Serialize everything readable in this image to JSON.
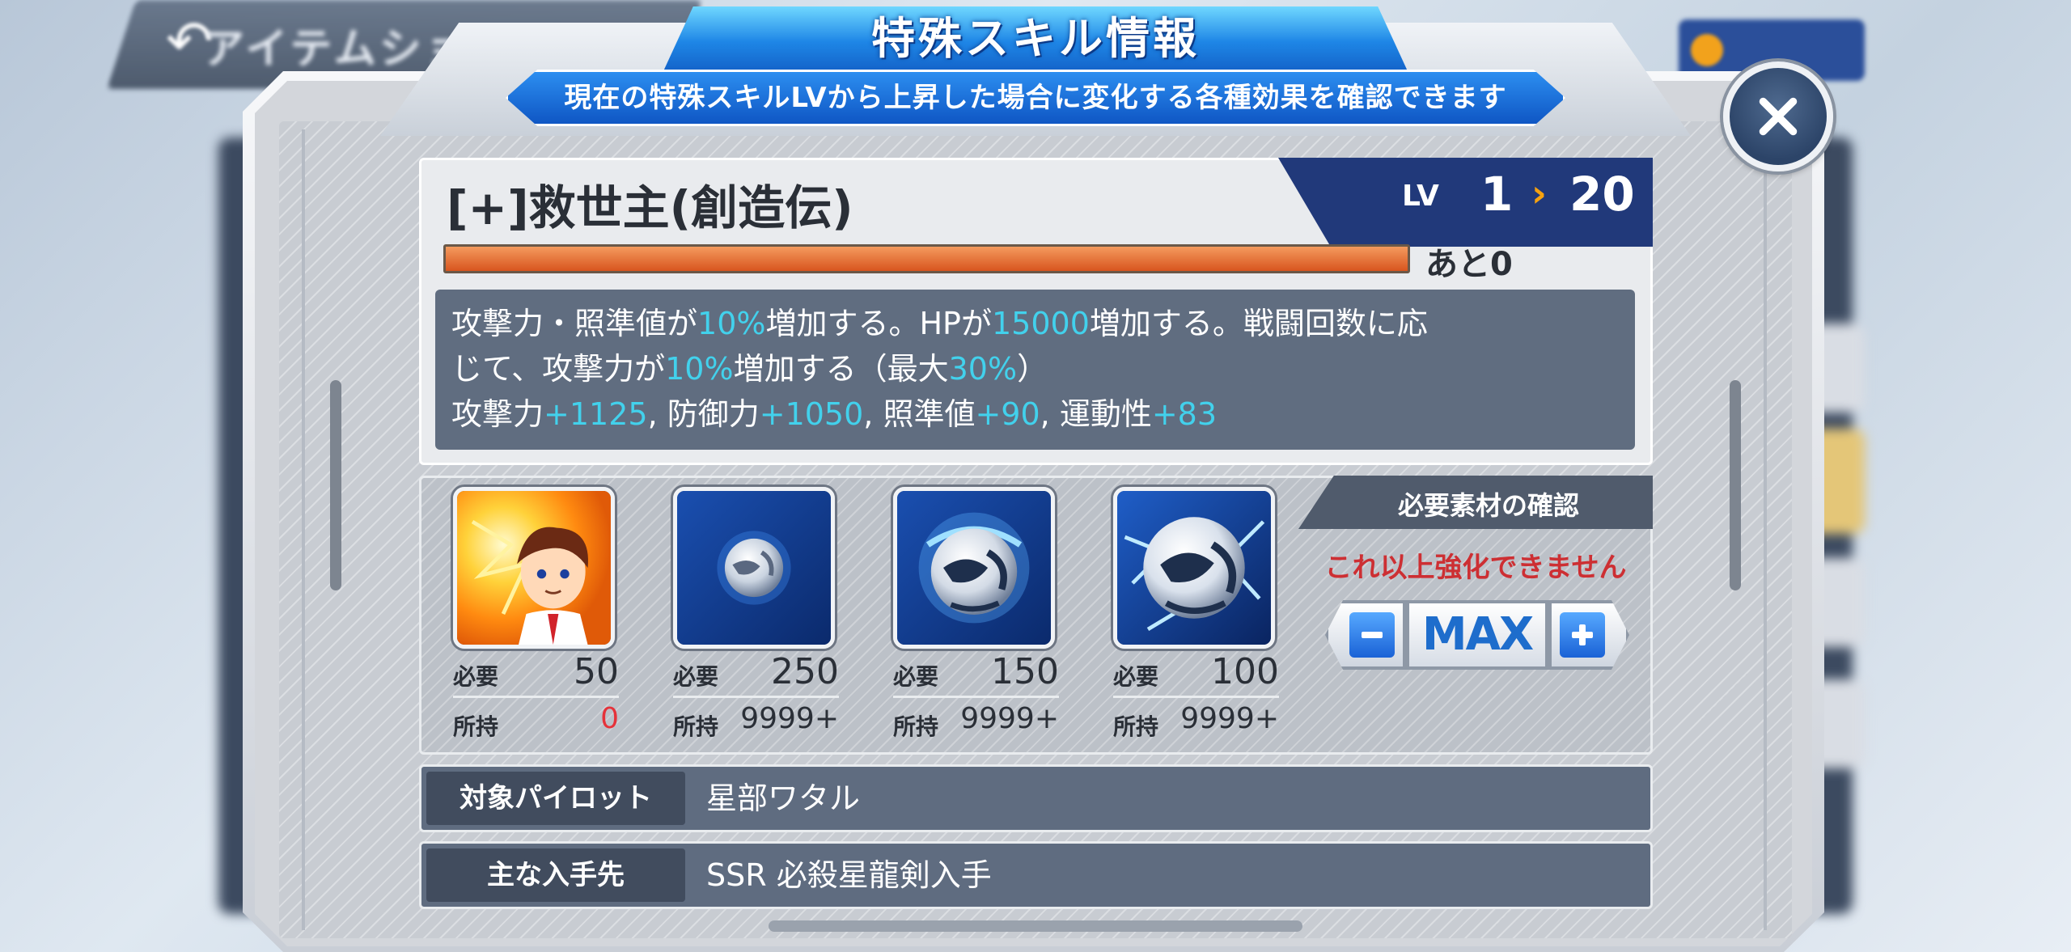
{
  "background": {
    "back_button_text": "アイテムショップ"
  },
  "header": {
    "title": "特殊スキル情報",
    "subtitle": "現在の特殊スキルLVから上昇した場合に変化する各種効果を確認できます"
  },
  "skill": {
    "name": "[+]救世主(創造伝)",
    "lv_label": "LV",
    "lv_from": "1",
    "lv_arrow": "›",
    "lv_to": "20",
    "exp_fill_fraction": 1.0,
    "exp_remaining": "あと0",
    "description": {
      "line1_parts": [
        "攻撃力・照準値が",
        "10%",
        "増加する。HPが",
        "15000",
        "増加する。戦闘回数に応"
      ],
      "line2_parts": [
        "じて、攻撃力が",
        "10%",
        "増加する（最大",
        "30%",
        "）"
      ],
      "line3_parts": [
        "攻撃力",
        "+1125",
        ", 防御力",
        "+1050",
        ", 照準値",
        "+90",
        ", 運動性",
        "+83"
      ]
    }
  },
  "materials": [
    {
      "icon": "pilot-portrait-icon",
      "need_label": "必要",
      "need": "50",
      "have_label": "所持",
      "have": "0",
      "have_insufficient": true
    },
    {
      "icon": "small-orb-icon",
      "need_label": "必要",
      "need": "250",
      "have_label": "所持",
      "have": "9999+",
      "have_insufficient": false
    },
    {
      "icon": "medium-orb-icon",
      "need_label": "必要",
      "need": "150",
      "have_label": "所持",
      "have": "9999+",
      "have_insufficient": false
    },
    {
      "icon": "large-orb-icon",
      "need_label": "必要",
      "need": "100",
      "have_label": "所持",
      "have": "9999+",
      "have_insufficient": false
    }
  ],
  "confirm": {
    "title": "必要素材の確認",
    "message": "これ以上強化できません",
    "max_label": "MAX"
  },
  "info": {
    "pilot_label": "対象パイロット",
    "pilot_value": "星部ワタル",
    "source_label": "主な入手先",
    "source_value": "SSR 必殺星龍剣入手"
  },
  "colors": {
    "accent_blue": "#1e86e6",
    "highlight_cyan": "#42d1ec",
    "warning_red": "#cd2f33",
    "exp_orange": "#d8551f",
    "lv_arrow": "#f6a20f"
  }
}
